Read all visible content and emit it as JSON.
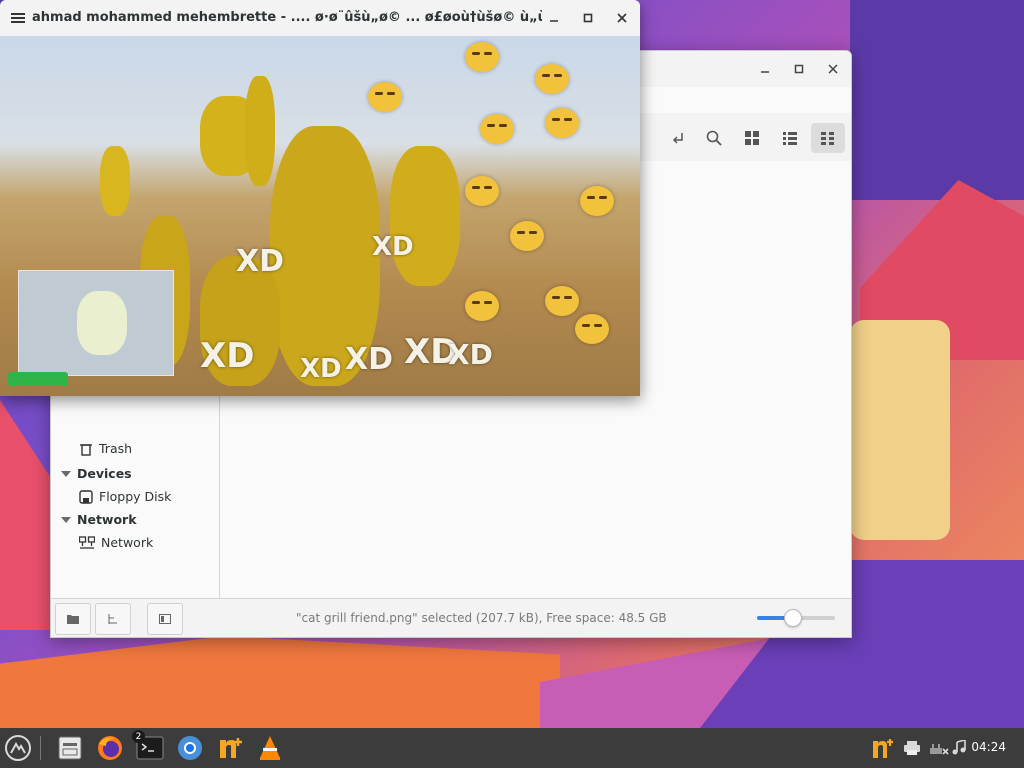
{
  "viewer": {
    "title": "ahmad mohammed mehembrette - .... ø·ø¨ûšù„ø© ... ø£øoù†ùšø© ù„ù„ø£ø·..."
  },
  "image_overlay": {
    "labels": [
      "XD",
      "XD",
      "XD",
      "XD",
      "XD",
      "XD",
      "XD"
    ]
  },
  "file_manager": {
    "sidebar": {
      "trash_label": "Trash",
      "devices_heading": "Devices",
      "floppy_label": "Floppy Disk",
      "network_heading": "Network",
      "network_label": "Network"
    },
    "status_text": "\"cat grill friend.png\" selected (207.7 kB), Free space: 48.5 GB",
    "zoom_level": 0.45
  },
  "taskbar": {
    "clock": "04:24",
    "terminal_badge": "2"
  },
  "colors": {
    "accent": "#3584e4",
    "taskbar": "#3c3c3c",
    "emoji_yellow": "#f2c23c"
  },
  "icons": [
    "menu-icon",
    "minimize-icon",
    "maximize-icon",
    "close-icon",
    "search-icon",
    "grid-view-icon",
    "list-view-icon",
    "compact-view-icon",
    "trash-icon",
    "floppy-icon",
    "network-icon",
    "folder-icon",
    "tree-icon",
    "sidebar-toggle-icon",
    "app-menu-icon",
    "file-manager-icon",
    "firefox-icon",
    "terminal-icon",
    "chromium-icon",
    "vlc-icon",
    "update-icon",
    "printer-icon",
    "network-status-icon",
    "audio-icon"
  ]
}
